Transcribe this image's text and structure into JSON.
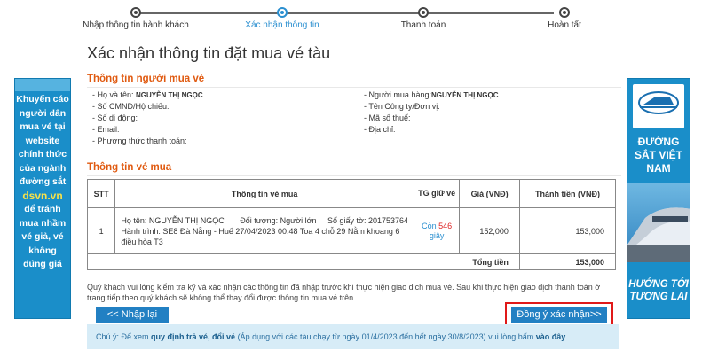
{
  "stepper": {
    "steps": [
      {
        "label": "Nhập thông tin hành khách"
      },
      {
        "label": "Xác nhận thông tin"
      },
      {
        "label": "Thanh toán"
      },
      {
        "label": "Hoàn tất"
      }
    ],
    "active_index": 1
  },
  "page_title": "Xác nhận thông tin đặt mua vé tàu",
  "buyer": {
    "section_title": "Thông tin người mua vé",
    "name_label": "- Họ và tên: ",
    "name_value": "NGUYỄN THỊ NGỌC",
    "id_label": "- Số CMND/Hộ chiếu:",
    "phone_label": "- Số di động:",
    "email_label": "- Email:",
    "payment_label": "- Phương thức thanh toán:",
    "payer_label": "- Người mua hàng:",
    "payer_value": "NGUYỄN THỊ NGỌC",
    "company_label": "- Tên Công ty/Đơn vị:",
    "tax_label": "- Mã số thuế:",
    "address_label": "- Địa chỉ:"
  },
  "ticket": {
    "section_title": "Thông tin vé mua",
    "headers": {
      "stt": "STT",
      "info": "Thông tin vé mua",
      "hold": "TG giữ vé",
      "price": "Giá (VNĐ)",
      "amount": "Thành tiền (VNĐ)"
    },
    "rows": [
      {
        "stt": "1",
        "line1_name": "Họ tên: NGUYỄN THỊ NGỌC",
        "line1_type": "Đối tượng: Người lớn",
        "line1_doc": "Số giấy tờ: 201753764",
        "line2": "Hành trình: SE8 Đà Nẵng - Huế 27/04/2023 00:48 Toa 4 chỗ 29 Nằm khoang 6 điều hòa T3",
        "hold_prefix": "Còn ",
        "hold_seconds": "546",
        "hold_suffix": "giây",
        "price": "152,000",
        "amount": "153,000"
      }
    ],
    "total_label": "Tổng tiền",
    "total_value": "153,000"
  },
  "note": "Quý khách vui lòng kiểm tra kỹ và xác nhận các thông tin đã nhập trước khi thực hiện giao dịch mua vé. Sau khi thực hiện giao dịch thanh toán ở trang tiếp theo quý khách sẽ không thể thay đổi được thông tin mua vé trên.",
  "buttons": {
    "back": "<< Nhập lại",
    "confirm": "Đồng ý xác nhận>>"
  },
  "footnote": {
    "prefix": "Chú ý: Để xem ",
    "link1": "quy định trả vé, đổi vé",
    "middle": " (Áp dụng với các tàu chạy từ ngày 01/4/2023 đến hết ngày 30/8/2023) vui lòng bấm ",
    "link2": "vào đây"
  },
  "banner_left": {
    "line1": "Khuyến cáo người dân mua vé tại website chính thức của ngành đường sắt",
    "site": "dsvn.vn",
    "line2": "để tránh mua nhầm vé giả, vé không đúng giá"
  },
  "banner_right": {
    "logo_text": "ĐƯỜNG SẮT VIỆT NAM",
    "title": "ĐƯỜNG SẮT VIỆT NAM",
    "slogan": "HƯỚNG TỚI TƯƠNG LAI"
  },
  "colors": {
    "accent_blue": "#2280c3",
    "section_orange": "#e05a10",
    "highlight_red": "#e01919",
    "banner_blue": "#1a8ec9"
  }
}
